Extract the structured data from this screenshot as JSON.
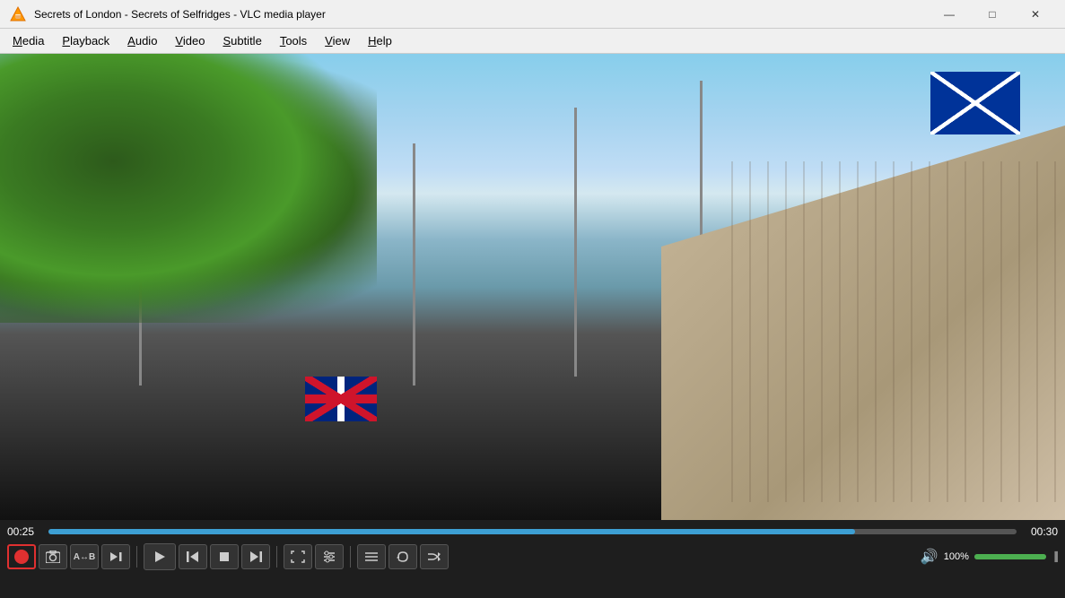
{
  "window": {
    "title": "Secrets of London - Secrets of Selfridges - VLC media player",
    "vlc_icon": "▶",
    "controls": {
      "minimize": "—",
      "maximize": "□",
      "close": "✕"
    }
  },
  "menu": {
    "items": [
      {
        "id": "media",
        "label": "Media",
        "underline_index": 0
      },
      {
        "id": "playback",
        "label": "Playback",
        "underline_index": 0
      },
      {
        "id": "audio",
        "label": "Audio",
        "underline_index": 0
      },
      {
        "id": "video",
        "label": "Video",
        "underline_index": 0
      },
      {
        "id": "subtitle",
        "label": "Subtitle",
        "underline_index": 0
      },
      {
        "id": "tools",
        "label": "Tools",
        "underline_index": 0
      },
      {
        "id": "view",
        "label": "View",
        "underline_index": 0
      },
      {
        "id": "help",
        "label": "Help",
        "underline_index": 0
      }
    ]
  },
  "player": {
    "current_time": "00:25",
    "total_time": "00:30",
    "progress_pct": 83.3,
    "volume_pct": 100,
    "volume_label": "100%",
    "is_recording": true,
    "is_playing": false
  },
  "controls": {
    "row1": {
      "record_label": "⏺",
      "snapshot_label": "📷",
      "ab_loop_label": "AB",
      "frame_step_label": "⏭",
      "play_label": "▶",
      "prev_label": "⏮",
      "stop_label": "■",
      "next_label": "⏭",
      "fullscreen_label": "⛶",
      "extended_label": "⑆",
      "playlist_label": "≡",
      "loop_label": "↺",
      "shuffle_label": "⇌"
    },
    "volume_icon": "🔊"
  }
}
